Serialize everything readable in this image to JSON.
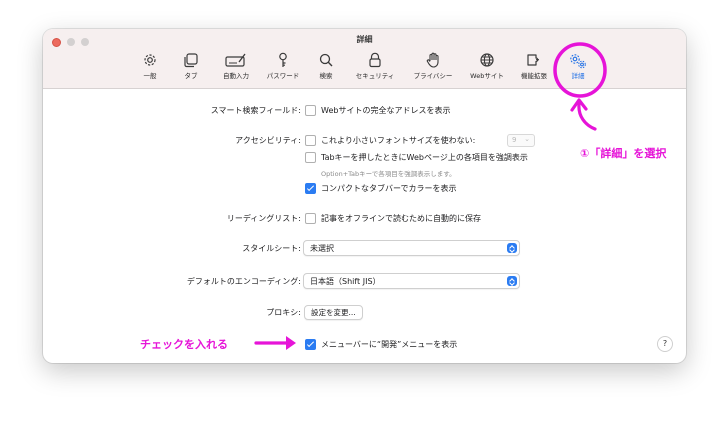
{
  "window": {
    "title": "詳細"
  },
  "toolbar": {
    "tabs": [
      {
        "label": "一般",
        "icon": "gear-icon"
      },
      {
        "label": "タブ",
        "icon": "tabs-icon"
      },
      {
        "label": "自動入力",
        "icon": "autofill-icon"
      },
      {
        "label": "パスワード",
        "icon": "key-icon"
      },
      {
        "label": "検索",
        "icon": "search-icon"
      },
      {
        "label": "セキュリティ",
        "icon": "lock-icon"
      },
      {
        "label": "プライバシー",
        "icon": "hand-icon"
      },
      {
        "label": "Webサイト",
        "icon": "globe-icon"
      },
      {
        "label": "機能拡張",
        "icon": "puzzle-icon"
      },
      {
        "label": "詳細",
        "icon": "gears-icon",
        "active": true
      }
    ]
  },
  "settings": {
    "smart_search": {
      "label": "スマート検索フィールド:",
      "option": "Webサイトの完全なアドレスを表示",
      "checked": false
    },
    "accessibility": {
      "label": "アクセシビリティ:",
      "font_option": "これより小さいフォントサイズを使わない:",
      "font_size": "9",
      "font_checked": false,
      "tab_option": "Tabキーを押したときにWebページ上の各項目を強調表示",
      "tab_checked": false,
      "tab_hint": "Option+Tabキーで各項目を強調表示します。",
      "compact_option": "コンパクトなタブバーでカラーを表示",
      "compact_checked": true
    },
    "reading_list": {
      "label": "リーディングリスト:",
      "option": "記事をオフラインで読むために自動的に保存",
      "checked": false
    },
    "stylesheet": {
      "label": "スタイルシート:",
      "value": "未選択"
    },
    "encoding": {
      "label": "デフォルトのエンコーディング:",
      "value": "日本語（Shift JIS）"
    },
    "proxy": {
      "label": "プロキシ:",
      "button": "設定を変更..."
    },
    "develop_menu": {
      "option": "メニューバーに“開発”メニューを表示",
      "checked": true
    },
    "help": "?"
  },
  "annotations": {
    "step1": "①「詳細」を選択",
    "check": "チェックを入れる",
    "color": "#e614d8"
  }
}
